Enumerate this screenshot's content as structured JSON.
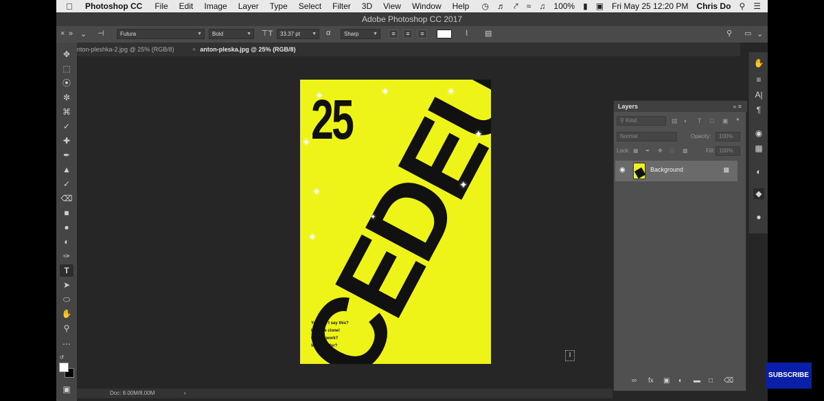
{
  "menubar": {
    "apple_icon": "apple-icon",
    "app_name": "Photoshop CC",
    "items": [
      "File",
      "Edit",
      "Image",
      "Layer",
      "Type",
      "Select",
      "Filter",
      "3D",
      "View",
      "Window",
      "Help"
    ],
    "battery": "100%",
    "datetime": "Fri May 25  12:20 PM",
    "user": "Chris Do"
  },
  "window": {
    "title": "Adobe Photoshop CC 2017"
  },
  "options": {
    "font_family": "Futura",
    "font_style": "Bold",
    "font_size": "33.37 pt",
    "anti_alias": "Sharp",
    "text_color": "#ffffff"
  },
  "tabs": [
    {
      "label": "nton-pleshka-2.jpg @ 25% (RGB/8)",
      "active": false
    },
    {
      "label": "anton-pleska.jpg @ 25% (RGB/8)",
      "active": true
    }
  ],
  "tools": [
    "move-icon",
    "marquee-icon",
    "lasso-icon",
    "quick-select-icon",
    "crop-icon",
    "eyedropper-icon",
    "healing-icon",
    "brush-icon",
    "stamp-icon",
    "history-brush-icon",
    "eraser-icon",
    "gradient-icon",
    "blur-icon",
    "dodge-icon",
    "pen-icon",
    "type-icon",
    "path-select-icon",
    "shape-icon",
    "hand-icon",
    "zoom-icon",
    "more-icon"
  ],
  "canvas": {
    "background_color": "#eef418",
    "number": "25",
    "word": "CEDEUIINE",
    "copy_lines": [
      "You don't say this?",
      "I am the clone!",
      "Does it work?",
      "Who is it for?"
    ]
  },
  "layers": {
    "title": "Layers",
    "filter_placeholder": "Kind",
    "blend_mode": "Normal",
    "opacity_label": "Opacity:",
    "opacity_value": "100%",
    "lock_label": "Lock:",
    "fill_label": "Fill:",
    "fill_value": "100%",
    "rows": [
      {
        "name": "Background",
        "visible": true,
        "locked": true
      }
    ]
  },
  "status": {
    "doc": "Doc: 8.00M/8.00M"
  },
  "overlay": {
    "subscribe": "SUBSCRIBE"
  }
}
